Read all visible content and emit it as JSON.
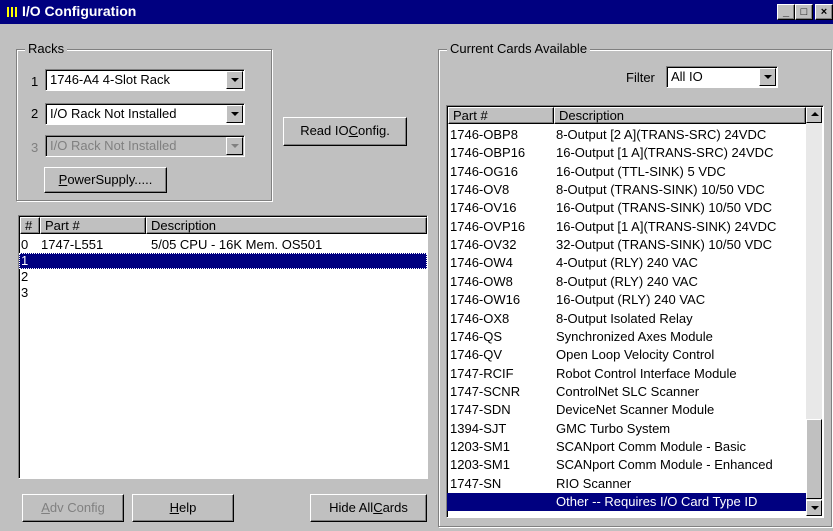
{
  "window": {
    "title": "I/O Configuration",
    "min_label": "_",
    "max_label": "□",
    "close_label": "×"
  },
  "racks": {
    "group_label": "Racks",
    "rows": [
      {
        "num": "1",
        "value": "1746-A4  4-Slot Rack",
        "enabled": true
      },
      {
        "num": "2",
        "value": "I/O Rack Not Installed",
        "enabled": true
      },
      {
        "num": "3",
        "value": "I/O Rack Not Installed",
        "enabled": false
      }
    ],
    "power_supply_label": "PowerSupply.....",
    "power_supply_mnemonic": "P",
    "power_supply_rest": "owerSupply....."
  },
  "read_io": {
    "label_prefix": "Read IO ",
    "mnemonic": "C",
    "label_suffix": "onfig."
  },
  "slots": {
    "columns": [
      "#",
      "Part #",
      "Description"
    ],
    "rows": [
      {
        "num": "0",
        "part": "1747-L551",
        "desc": "5/05 CPU - 16K Mem. OS501"
      },
      {
        "num": "1",
        "part": "",
        "desc": ""
      },
      {
        "num": "2",
        "part": "",
        "desc": ""
      },
      {
        "num": "3",
        "part": "",
        "desc": ""
      }
    ],
    "selected_index": 1
  },
  "buttons": {
    "adv_config": {
      "mnemonic": "A",
      "rest": "dv Config"
    },
    "help": {
      "mnemonic": "H",
      "rest": "elp"
    },
    "hide_all": {
      "prefix": "Hide All ",
      "mnemonic": "C",
      "rest": "ards"
    }
  },
  "cards": {
    "group_label": "Current Cards Available",
    "filter_label": "Filter",
    "filter_value": "All IO",
    "columns": [
      "Part #",
      "Description"
    ],
    "rows": [
      {
        "part": "1746-OBP8",
        "desc": "8-Output [2 A](TRANS-SRC) 24VDC"
      },
      {
        "part": "1746-OBP16",
        "desc": "16-Output [1 A](TRANS-SRC) 24VDC"
      },
      {
        "part": "1746-OG16",
        "desc": "16-Output (TTL-SINK) 5 VDC"
      },
      {
        "part": "1746-OV8",
        "desc": "8-Output (TRANS-SINK) 10/50 VDC"
      },
      {
        "part": "1746-OV16",
        "desc": "16-Output (TRANS-SINK) 10/50 VDC"
      },
      {
        "part": "1746-OVP16",
        "desc": "16-Output [1 A](TRANS-SINK) 24VDC"
      },
      {
        "part": "1746-OV32",
        "desc": "32-Output (TRANS-SINK) 10/50 VDC"
      },
      {
        "part": "1746-OW4",
        "desc": "4-Output (RLY) 240 VAC"
      },
      {
        "part": "1746-OW8",
        "desc": "8-Output (RLY) 240 VAC"
      },
      {
        "part": "1746-OW16",
        "desc": "16-Output (RLY) 240 VAC"
      },
      {
        "part": "1746-OX8",
        "desc": "8-Output Isolated Relay"
      },
      {
        "part": "1746-QS",
        "desc": "Synchronized Axes Module"
      },
      {
        "part": "1746-QV",
        "desc": "Open Loop Velocity Control"
      },
      {
        "part": "1747-RCIF",
        "desc": "Robot Control Interface Module"
      },
      {
        "part": "1747-SCNR",
        "desc": "ControlNet SLC Scanner"
      },
      {
        "part": "1747-SDN",
        "desc": "DeviceNet Scanner Module"
      },
      {
        "part": "1394-SJT",
        "desc": "GMC Turbo System"
      },
      {
        "part": "1203-SM1",
        "desc": "SCANport Comm Module - Basic"
      },
      {
        "part": "1203-SM1",
        "desc": "SCANport Comm Module - Enhanced"
      },
      {
        "part": "1747-SN",
        "desc": "RIO Scanner"
      },
      {
        "part": "",
        "desc": "Other -- Requires I/O Card Type ID"
      }
    ],
    "selected_index": 20
  }
}
